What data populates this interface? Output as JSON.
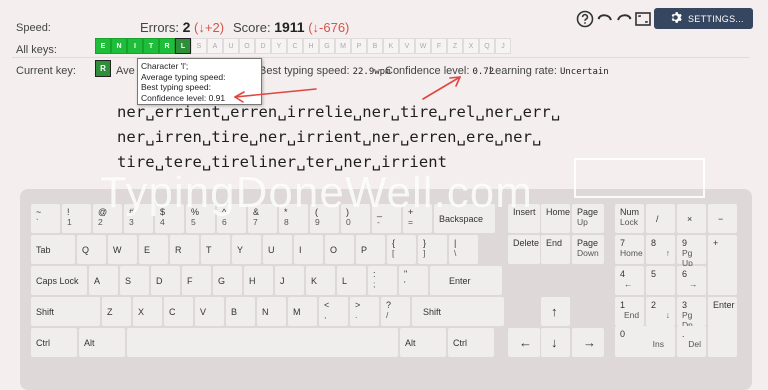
{
  "stats": {
    "speed_label": "Speed:",
    "errors_label": "Errors:",
    "errors_value": "2",
    "errors_delta": "(↓+2)",
    "score_label": "Score:",
    "score_value": "1911",
    "score_delta": "(↓-676)"
  },
  "toolbar": {
    "settings_label": "SETTINGS..."
  },
  "keys": {
    "label": "All keys:",
    "items": [
      "E",
      "N",
      "I",
      "T",
      "R",
      "L",
      "S",
      "A",
      "U",
      "O",
      "D",
      "Y",
      "C",
      "H",
      "G",
      "M",
      "P",
      "B",
      "K",
      "V",
      "W",
      "F",
      "Z",
      "X",
      "Q",
      "J"
    ],
    "active_count": 6,
    "current_index": 5
  },
  "current_key": {
    "label": "Current key:",
    "key": "R",
    "avg_label": "Ave",
    "best_label": "Best typing speed:",
    "best_value": "22.9wpm",
    "confidence_label": "Confidence level:",
    "confidence_value": "0.72",
    "learning_label": "Learning rate:",
    "learning_value": "Uncertain"
  },
  "tooltip": {
    "line1": "Character 'l';",
    "line2": "Average typing speed:",
    "line3": "Best typing speed:",
    "line4": "Confidence level: 0.91"
  },
  "practice": {
    "line1": "ner␣errient␣erren␣irrelie␣ner␣tire␣rel␣ner␣err␣",
    "line2": "ner␣irren␣tire␣ner␣irrient␣ner␣erren␣ere␣ner␣",
    "line3": "tire␣tere␣tireliner␣ter␣ner␣irrient"
  },
  "watermark": "TypingDoneWell.com",
  "keyboard": {
    "row1": [
      [
        "~",
        "`"
      ],
      [
        "!",
        "1"
      ],
      [
        "@",
        "2"
      ],
      [
        "#",
        "3"
      ],
      [
        "$",
        "4"
      ],
      [
        "%",
        "5"
      ],
      [
        "^",
        "6"
      ],
      [
        "&",
        "7"
      ],
      [
        "*",
        "8"
      ],
      [
        "(",
        "9"
      ],
      [
        ")",
        "0"
      ],
      [
        "_",
        "-"
      ],
      [
        "+",
        "="
      ],
      [
        "Backspace",
        ""
      ]
    ],
    "row2": [
      [
        "Tab",
        ""
      ],
      [
        "Q",
        ""
      ],
      [
        "W",
        ""
      ],
      [
        "E",
        ""
      ],
      [
        "R",
        ""
      ],
      [
        "T",
        ""
      ],
      [
        "Y",
        ""
      ],
      [
        "U",
        ""
      ],
      [
        "I",
        ""
      ],
      [
        "O",
        ""
      ],
      [
        "P",
        ""
      ],
      [
        "{",
        "["
      ],
      [
        "}",
        "]"
      ],
      [
        "|",
        "\\"
      ]
    ],
    "row3": [
      [
        "Caps Lock",
        ""
      ],
      [
        "A",
        ""
      ],
      [
        "S",
        ""
      ],
      [
        "D",
        ""
      ],
      [
        "F",
        ""
      ],
      [
        "G",
        ""
      ],
      [
        "H",
        ""
      ],
      [
        "J",
        ""
      ],
      [
        "K",
        ""
      ],
      [
        "L",
        ""
      ],
      [
        ":",
        ";"
      ],
      [
        "\"",
        "'"
      ],
      [
        "Enter",
        ""
      ]
    ],
    "row4": [
      [
        "Shift",
        ""
      ],
      [
        "Z",
        ""
      ],
      [
        "X",
        ""
      ],
      [
        "C",
        ""
      ],
      [
        "V",
        ""
      ],
      [
        "B",
        ""
      ],
      [
        "N",
        ""
      ],
      [
        "M",
        ""
      ],
      [
        "<",
        ","
      ],
      [
        ">",
        "."
      ],
      [
        "?",
        "/"
      ],
      [
        "Shift",
        ""
      ]
    ],
    "row5": [
      [
        "Ctrl",
        ""
      ],
      [
        "Alt",
        ""
      ],
      [
        "",
        ""
      ],
      [
        "Alt",
        ""
      ],
      [
        "Ctrl",
        ""
      ]
    ],
    "nav": {
      "insert": "Insert",
      "home": "Home",
      "pageup": [
        "Page",
        "Up"
      ],
      "delete": "Delete",
      "end": "End",
      "pagedown": [
        "Page",
        "Down"
      ],
      "up": "↑",
      "left": "←",
      "down": "↓",
      "right": "→"
    },
    "numpad": {
      "numlock": [
        "Num",
        "Lock"
      ],
      "slash": "/",
      "star": "×",
      "minus": "−",
      "n7": [
        "7",
        "Home"
      ],
      "n8": [
        "8",
        "↑"
      ],
      "n9": [
        "9",
        "Pg Up"
      ],
      "plus": "+",
      "n4": [
        "4",
        "←"
      ],
      "n5": [
        "5",
        ""
      ],
      "n6": [
        "6",
        "→"
      ],
      "n1": [
        "1",
        "End"
      ],
      "n2": [
        "2",
        "↓"
      ],
      "n3": [
        "3",
        "Pg Dn"
      ],
      "enter": "Enter",
      "n0": [
        "0",
        "Ins"
      ],
      "dot": [
        ".",
        "Del"
      ]
    }
  },
  "colors": {
    "active_key": "#1fbe3a",
    "current_key": "#2e8f3b",
    "settings_bg": "#354660",
    "delta_red": "#d2554f",
    "arrow_red": "#e0453f"
  }
}
